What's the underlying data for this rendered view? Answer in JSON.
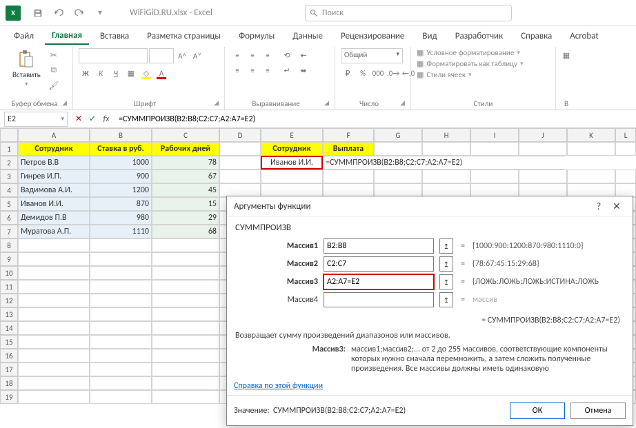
{
  "title": "WiFiGiD.RU.xlsx - Excel",
  "search_placeholder": "Поиск",
  "ribbon_tabs": {
    "file": "Файл",
    "home": "Главная",
    "insert": "Вставка",
    "page_layout": "Разметка страницы",
    "formulas": "Формулы",
    "data": "Данные",
    "review": "Рецензирование",
    "view": "Вид",
    "developer": "Разработчик",
    "help": "Справка",
    "acrobat": "Acrobat"
  },
  "ribbon_groups": {
    "clipboard": {
      "label": "Буфер обмена",
      "paste": "Вставить"
    },
    "font": {
      "label": "Шрифт",
      "aa_inc": "A^",
      "aa_dec": "A˅",
      "bold": "Ж",
      "italic": "К",
      "underline": "Ч"
    },
    "alignment": {
      "label": "Выравнивание"
    },
    "number": {
      "label": "Число",
      "format": "Общий"
    },
    "styles": {
      "label": "Стили",
      "cond_fmt": "Условное форматирование",
      "as_table": "Форматировать как таблицу",
      "cell_styles": "Стили ячеек"
    },
    "cells": {
      "label": "В"
    }
  },
  "name_box": "E2",
  "formula_bar": "=СУММПРОИЗВ(B2:B8;C2:C7;A2:A7=E2)",
  "columns": {
    "A": "A",
    "B": "B",
    "C": "C",
    "D": "D",
    "E": "E",
    "F": "F",
    "G": "G",
    "H": "H",
    "I": "I",
    "J": "J",
    "K": "K",
    "L": "L"
  },
  "row_nums": [
    "1",
    "2",
    "3",
    "4",
    "5",
    "6",
    "7",
    "8",
    "9",
    "10",
    "11",
    "12",
    "13",
    "14",
    "15",
    "16",
    "17",
    "18",
    "19"
  ],
  "headers": {
    "A": "Сотрудник",
    "B": "Ставка в руб.",
    "C": "Рабочих дней",
    "E": "Сотрудник",
    "F": "Выплата"
  },
  "table": [
    {
      "a": "Петров В.В",
      "b": "1000",
      "c": "78"
    },
    {
      "a": "Гинрев И.П.",
      "b": "900",
      "c": "67"
    },
    {
      "a": "Вадимова А.И.",
      "b": "1200",
      "c": "45"
    },
    {
      "a": "Иванов И.И.",
      "b": "870",
      "c": "15"
    },
    {
      "a": "Демидов П.В",
      "b": "980",
      "c": "29"
    },
    {
      "a": "Муратова А.П.",
      "b": "1110",
      "c": "68"
    }
  ],
  "lookup": {
    "name": "Иванов И.И.",
    "formula_display": "=СУММПРОИЗВ(B2:B8;C2:C7;A2:A7=E2)"
  },
  "dialog": {
    "title": "Аргументы функции",
    "func": "СУММПРОИЗВ",
    "args_labels": {
      "m1": "Массив1",
      "m2": "Массив2",
      "m3": "Массив3",
      "m4": "Массив4"
    },
    "args": {
      "m1": "B2:B8",
      "m2": "C2:C7",
      "m3": "A2:A7=E2",
      "m4": ""
    },
    "previews": {
      "m1": "{1000:900:1200:870:980:1110:0}",
      "m2": "{78:67:45:15:29:68}",
      "m3": "{ЛОЖЬ:ЛОЖЬ:ЛОЖЬ:ИСТИНА:ЛОЖЬ",
      "m4": "массив"
    },
    "eq": "=",
    "result_line": "=  СУММПРОИЗВ(B2:B8;C2:C7;A2:A7=E2)",
    "desc": "Возвращает сумму произведений диапазонов или массивов.",
    "arg_desc_label": "Массив3:",
    "arg_desc_text": "массив1;массив2;... от 2 до 255 массивов, соответствующие компоненты которых нужно сначала перемножить, а затем сложить полученные произведения. Все массивы должны иметь одинаковую",
    "value_label": "Значение:",
    "value": "СУММПРОИЗВ(B2:B8;C2:C7;A2:A7=E2)",
    "help_link": "Справка по этой функции",
    "ok": "ОК",
    "cancel": "Отмена",
    "help_icon": "?",
    "close_icon": "✕"
  }
}
